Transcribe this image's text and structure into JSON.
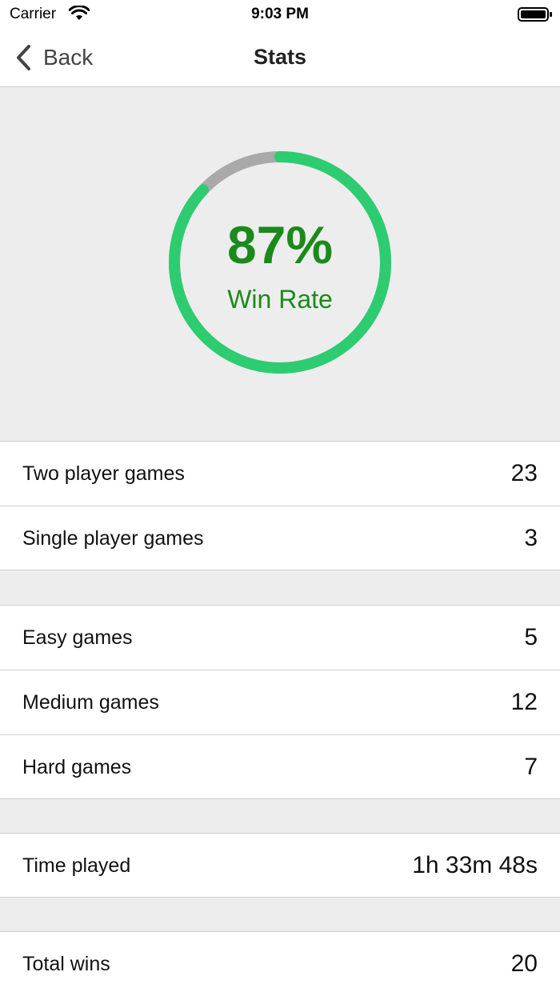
{
  "status_bar": {
    "carrier": "Carrier",
    "time": "9:03 PM",
    "wifi_icon": "wifi-icon",
    "battery_icon": "battery-icon"
  },
  "nav": {
    "back_label": "Back",
    "back_icon": "chevron-left-icon",
    "title": "Stats"
  },
  "win_rate": {
    "value_text": "87%",
    "label": "Win Rate",
    "fraction": 0.87,
    "ring_color": "#2ecc71",
    "track_color": "#a9a9a9",
    "text_color": "#1b8a1b"
  },
  "sections": [
    {
      "rows": [
        {
          "label": "Two player games",
          "value": "23"
        },
        {
          "label": "Single player games",
          "value": "3"
        }
      ]
    },
    {
      "rows": [
        {
          "label": "Easy games",
          "value": "5"
        },
        {
          "label": "Medium games",
          "value": "12"
        },
        {
          "label": "Hard games",
          "value": "7"
        }
      ]
    },
    {
      "rows": [
        {
          "label": "Time played",
          "value": "1h 33m 48s"
        }
      ]
    },
    {
      "rows": [
        {
          "label": "Total wins",
          "value": "20"
        }
      ]
    }
  ]
}
